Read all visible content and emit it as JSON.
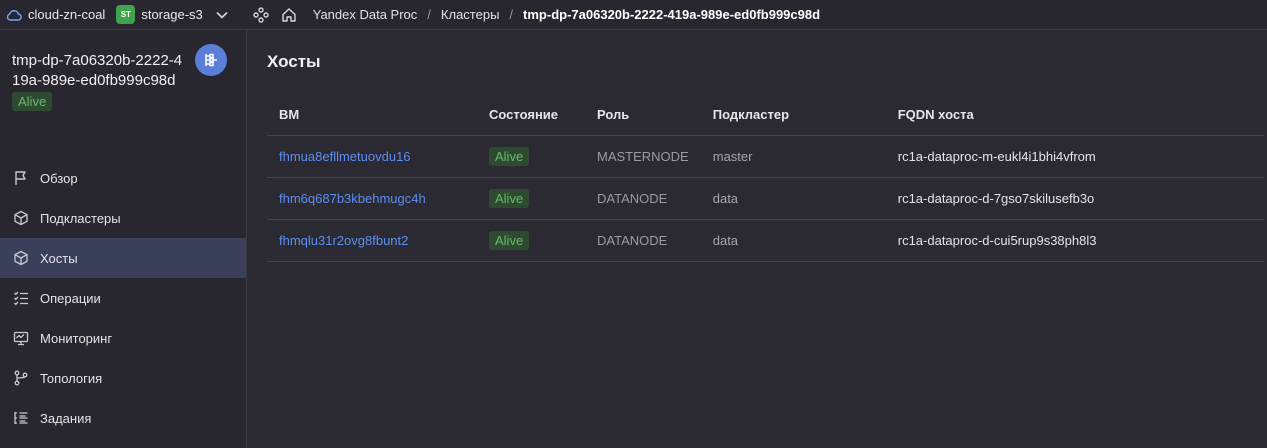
{
  "topbar": {
    "cloud_name": "cloud-zn-coal",
    "folder_badge": "ST",
    "folder_name": "storage-s3",
    "breadcrumbs": [
      "Yandex Data Proc",
      "Кластеры"
    ],
    "current": "tmp-dp-7a06320b-2222-419a-989e-ed0fb999c98d",
    "separator": "/"
  },
  "sidebar": {
    "cluster_name": "tmp-dp-7a06320b-2222-419a-989e-ed0fb999c98d",
    "cluster_status": "Alive",
    "items": [
      {
        "label": "Обзор",
        "icon": "flag-icon",
        "active": false
      },
      {
        "label": "Подкластеры",
        "icon": "cube-icon",
        "active": false
      },
      {
        "label": "Хосты",
        "icon": "cube-icon",
        "active": true
      },
      {
        "label": "Операции",
        "icon": "checklist-icon",
        "active": false
      },
      {
        "label": "Мониторинг",
        "icon": "monitor-icon",
        "active": false
      },
      {
        "label": "Топология",
        "icon": "topology-icon",
        "active": false
      },
      {
        "label": "Задания",
        "icon": "task-list-icon",
        "active": false
      }
    ]
  },
  "main": {
    "title": "Хосты",
    "columns": [
      "ВМ",
      "Состояние",
      "Роль",
      "Подкластер",
      "FQDN хоста"
    ],
    "rows": [
      {
        "vm": "fhmua8efllmetuovdu16",
        "status": "Alive",
        "role": "MASTERNODE",
        "subcluster": "master",
        "fqdn": "rc1a-dataproc-m-eukl4i1bhi4vfrom"
      },
      {
        "vm": "fhm6q687b3kbehmugc4h",
        "status": "Alive",
        "role": "DATANODE",
        "subcluster": "data",
        "fqdn": "rc1a-dataproc-d-7gso7skilusefb3o"
      },
      {
        "vm": "fhmqlu31r2ovg8fbunt2",
        "status": "Alive",
        "role": "DATANODE",
        "subcluster": "data",
        "fqdn": "rc1a-dataproc-d-cui5rup9s38ph8l3"
      }
    ]
  },
  "colors": {
    "accent": "#5c8ef0",
    "status_green": "#66bb6a",
    "active_nav": "#3a3f5a",
    "badge_green": "#3fa34d",
    "service_icon": "#5b7ed8"
  }
}
